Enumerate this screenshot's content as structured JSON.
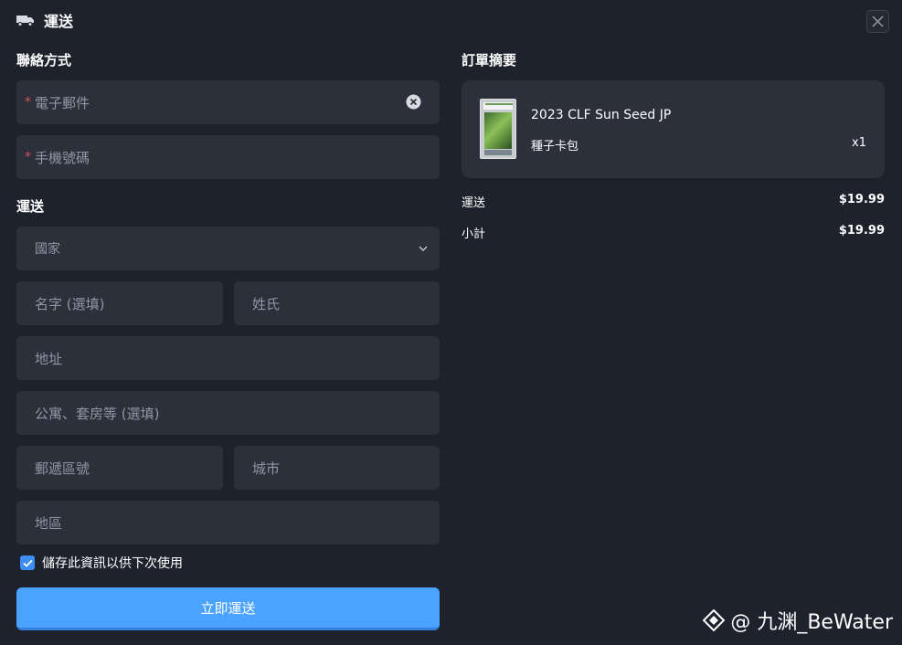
{
  "header": {
    "title": "運送",
    "icon": "truck-icon"
  },
  "contact": {
    "title": "聯絡方式",
    "email": {
      "placeholder": "電子郵件",
      "required_mark": "*"
    },
    "phone": {
      "placeholder": "手機號碼",
      "required_mark": "*"
    }
  },
  "shipping": {
    "title": "運送",
    "country": "國家",
    "first_name": "名字 (選填)",
    "last_name": "姓氏",
    "address": "地址",
    "apartment": "公寓、套房等 (選填)",
    "postal_code": "郵遞區號",
    "city": "城市",
    "region": "地區",
    "save_info": "儲存此資訊以供下次使用",
    "save_info_checked": true,
    "submit": "立即運送"
  },
  "summary": {
    "title": "訂單摘要",
    "item": {
      "name": "2023 CLF Sun Seed JP",
      "subtitle": "種子卡包",
      "qty": "x1"
    },
    "shipping_label": "運送",
    "shipping_amount": "$19.99",
    "subtotal_label": "小計",
    "subtotal_amount": "$19.99"
  },
  "watermark": {
    "text": "@ 九渊_BeWater"
  },
  "colors": {
    "background": "#1e222c",
    "field": "#2b303a",
    "accent": "#4aa3ff",
    "required": "#d65252"
  }
}
